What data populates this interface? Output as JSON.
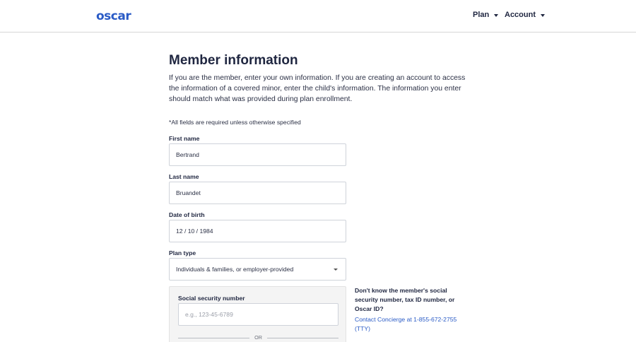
{
  "header": {
    "logo_text": "oscar",
    "nav": [
      {
        "label": "Plan"
      },
      {
        "label": "Account"
      }
    ]
  },
  "page": {
    "title": "Member information",
    "intro": "If you are the member, enter your own information. If you are creating an account to access the information of a covered minor, enter the child's information. The information you enter should match what was provided during plan enrollment.",
    "required_note": "*All fields are required unless otherwise specified"
  },
  "fields": {
    "first_name": {
      "label": "First name",
      "value": "Bertrand"
    },
    "last_name": {
      "label": "Last name",
      "value": "Bruandet"
    },
    "dob": {
      "label": "Date of birth",
      "value": "12 / 10 / 1984"
    },
    "plan_type": {
      "label": "Plan type",
      "value": "Individuals & families, or employer-provided"
    },
    "ssn": {
      "label": "Social security number",
      "placeholder": "e.g., 123-45-6789",
      "or_text": "OR"
    }
  },
  "help": {
    "question": "Don't know the member's social security number, tax ID number, or Oscar ID?",
    "contact": "Contact Concierge at 1-855-672-2755 (TTY)"
  },
  "colors": {
    "brand": "#2a5bc6",
    "text": "#1f2640",
    "border": "#cfd3da"
  }
}
